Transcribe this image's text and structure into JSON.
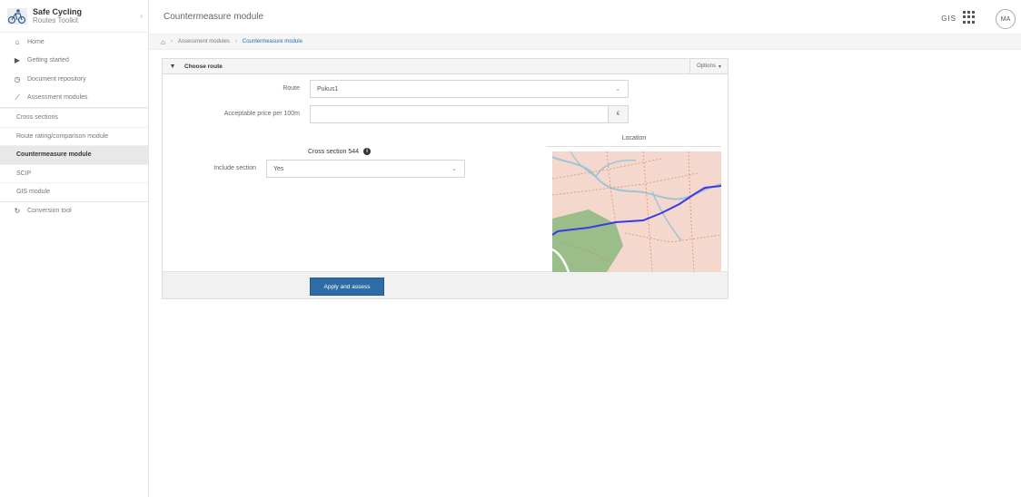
{
  "brand": {
    "title": "Safe Cycling",
    "subtitle": "Routes Toolkit"
  },
  "sidebar": {
    "items": [
      {
        "label": "Home",
        "icon": "home-icon"
      },
      {
        "label": "Getting started",
        "icon": "pointer-icon"
      },
      {
        "label": "Document repository",
        "icon": "document-icon"
      },
      {
        "label": "Assessment modules",
        "icon": "chart-icon"
      }
    ],
    "subitems": [
      {
        "label": "Cross sections",
        "active": false
      },
      {
        "label": "Route rating/comparison module",
        "active": false
      },
      {
        "label": "Countermeasure module",
        "active": true
      },
      {
        "label": "SCIP",
        "active": false
      },
      {
        "label": "GIS module",
        "active": false
      }
    ],
    "tail": {
      "label": "Conversion tool",
      "icon": "refresh-icon"
    }
  },
  "header": {
    "title": "Countermeasure module",
    "gis_label": "GIS",
    "avatar": "MA"
  },
  "breadcrumb": {
    "home_icon": "home-icon",
    "parent": "Assessment modules",
    "current": "Countermeasure module"
  },
  "panel": {
    "title": "Choose route",
    "options": "Options",
    "route_label": "Route",
    "route_value": "Pukus1",
    "price_label": "Acceptable price per 100m",
    "price_value": "",
    "currency": "€",
    "section_title": "Cross section 544",
    "include_label": "Include section",
    "include_value": "Yes",
    "location_title": "Location",
    "apply_button": "Apply and assess"
  },
  "colors": {
    "primary": "#2d6ca5",
    "active_nav": "#e8e8e8",
    "route_line": "#3a3ae6"
  }
}
